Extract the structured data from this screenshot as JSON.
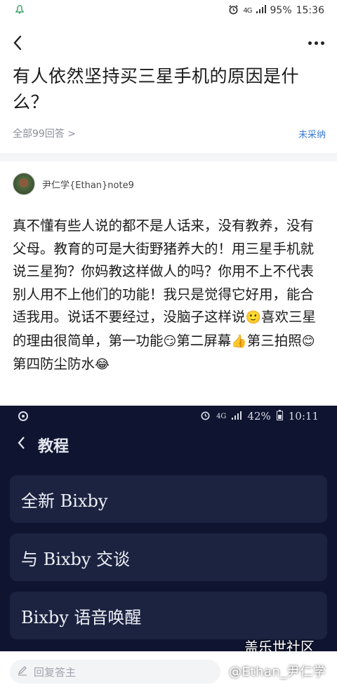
{
  "status_bar": {
    "network": "4G",
    "battery": "95%",
    "time": "15:36"
  },
  "question": {
    "title": "有人依然坚持买三星手机的原因是什么？",
    "answers_label": "全部99回答 >",
    "status_label": "未采纳"
  },
  "answer": {
    "author": "尹仁学{Ethan}note9",
    "segments": [
      "真不懂有些人说的都不是人话来，没有教养，没有父母。教育的可是大街野猪养大的！用三星手机就说三星狗？你妈教这样做人的吗？你用不上不代表别人用不上他们的功能！我只是觉得它好用，能合适我用。说话不要经过，没脑子这样说",
      "喜欢三星的理由很简单，第一功能",
      "第二屏幕",
      "第三拍照",
      "第四防尘防水"
    ],
    "emojis": [
      "🙂",
      "😏",
      "👍",
      "😊",
      "😂"
    ]
  },
  "embedded_screenshot": {
    "network": "4G",
    "battery": "42%",
    "time": "10:11",
    "title": "教程",
    "items": [
      "全新 Bixby",
      "与 Bixby 交谈",
      "Bixby 语音唤醒"
    ]
  },
  "watermark": {
    "site": "盖乐世社区",
    "user": "@Ethan_尹仁学"
  },
  "reply": {
    "placeholder": "回复答主"
  },
  "colors": {
    "link_blue": "#3a7bd5",
    "muted_gray": "#8a8f99",
    "embed_bg": "#0f1530",
    "embed_card": "#1c2340"
  }
}
